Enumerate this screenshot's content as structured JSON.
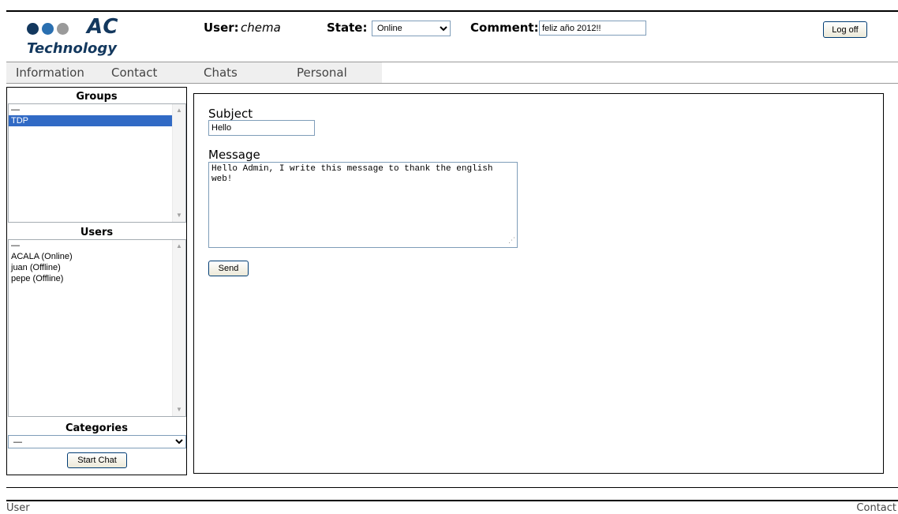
{
  "header": {
    "logo_text": "AC",
    "logo_subtext": "Technology",
    "user_label": "User:",
    "user_name": "chema",
    "state_label": "State:",
    "state_value": "Online",
    "comment_label": "Comment:",
    "comment_value": "feliz año 2012!!",
    "logoff_label": "Log off"
  },
  "nav": {
    "items": [
      "Information",
      "Contact",
      "Chats",
      "Personal"
    ]
  },
  "sidebar": {
    "groups_title": "Groups",
    "groups": [
      "—",
      "TDP"
    ],
    "groups_selected": "TDP",
    "users_title": "Users",
    "users": [
      "—",
      "ACALA (Online)",
      "juan (Offline)",
      "pepe (Offline)"
    ],
    "categories_title": "Categories",
    "categories_value": "—",
    "start_chat_label": "Start Chat"
  },
  "form": {
    "subject_label": "Subject",
    "subject_value": "Hello",
    "message_label": "Message",
    "message_value": "Hello Admin, I write this message to thank the english web!",
    "send_label": "Send"
  },
  "footer": {
    "left": "User",
    "right": "Contact"
  },
  "colors": {
    "logo_dark": "#13385e",
    "logo_blue": "#2a6fb0",
    "logo_gray": "#9a9a9a",
    "selection": "#316ac5"
  },
  "icons": [
    "chevron-down-icon",
    "scroll-up-icon",
    "scroll-down-icon",
    "resize-grip-icon"
  ]
}
